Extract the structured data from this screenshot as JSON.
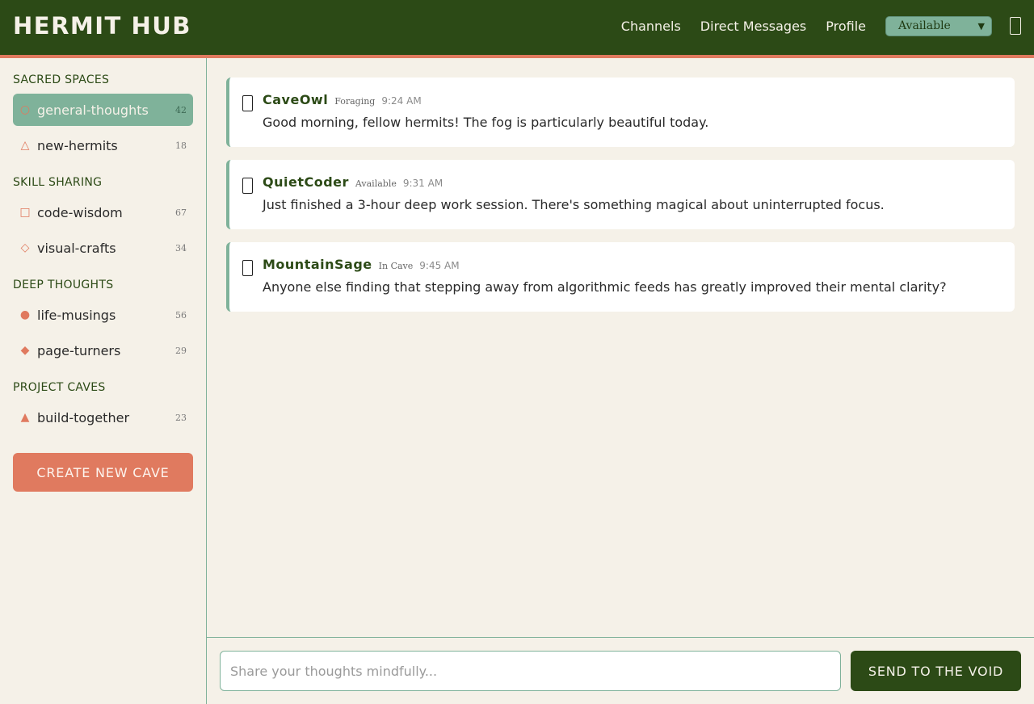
{
  "app": {
    "title": "HERMIT HUB"
  },
  "nav": {
    "links": [
      {
        "label": "Channels"
      },
      {
        "label": "Direct Messages"
      },
      {
        "label": "Profile"
      }
    ],
    "status_value": "Available",
    "notification_icon": "bell-icon"
  },
  "sidebar": {
    "sections": [
      {
        "title": "Sacred Spaces",
        "channels": [
          {
            "icon": "○",
            "icon_name": "circle-outline-icon",
            "name": "general-thoughts",
            "count": "42",
            "active": true
          },
          {
            "icon": "△",
            "icon_name": "triangle-outline-icon",
            "name": "new-hermits",
            "count": "18"
          }
        ]
      },
      {
        "title": "Skill Sharing",
        "channels": [
          {
            "icon": "□",
            "icon_name": "square-outline-icon",
            "name": "code-wisdom",
            "count": "67"
          },
          {
            "icon": "◇",
            "icon_name": "diamond-outline-icon",
            "name": "visual-crafts",
            "count": "34"
          }
        ]
      },
      {
        "title": "Deep Thoughts",
        "channels": [
          {
            "icon": "●",
            "icon_name": "circle-filled-icon",
            "name": "life-musings",
            "count": "56"
          },
          {
            "icon": "◆",
            "icon_name": "diamond-filled-icon",
            "name": "page-turners",
            "count": "29"
          }
        ]
      },
      {
        "title": "Project Caves",
        "channels": [
          {
            "icon": "▲",
            "icon_name": "triangle-filled-icon",
            "name": "build-together",
            "count": "23"
          }
        ]
      }
    ],
    "create_button": "CREATE NEW CAVE"
  },
  "messages": [
    {
      "author": "CaveOwl",
      "status": "Foraging",
      "time": "9:24 AM",
      "text": "Good morning, fellow hermits! The fog is particularly beautiful today."
    },
    {
      "author": "QuietCoder",
      "status": "Available",
      "time": "9:31 AM",
      "text": "Just finished a 3-hour deep work session. There's something magical about uninterrupted focus."
    },
    {
      "author": "MountainSage",
      "status": "In Cave",
      "time": "9:45 AM",
      "text": "Anyone else finding that stepping away from algorithmic feeds has greatly improved their mental clarity?"
    }
  ],
  "composer": {
    "placeholder": "Share your thoughts mindfully...",
    "value": "",
    "send_label": "SEND TO THE VOID"
  },
  "colors": {
    "header_bg": "#2c4a16",
    "accent": "#e07a5f",
    "sage": "#7fb29a",
    "background": "#f5f1e8"
  }
}
